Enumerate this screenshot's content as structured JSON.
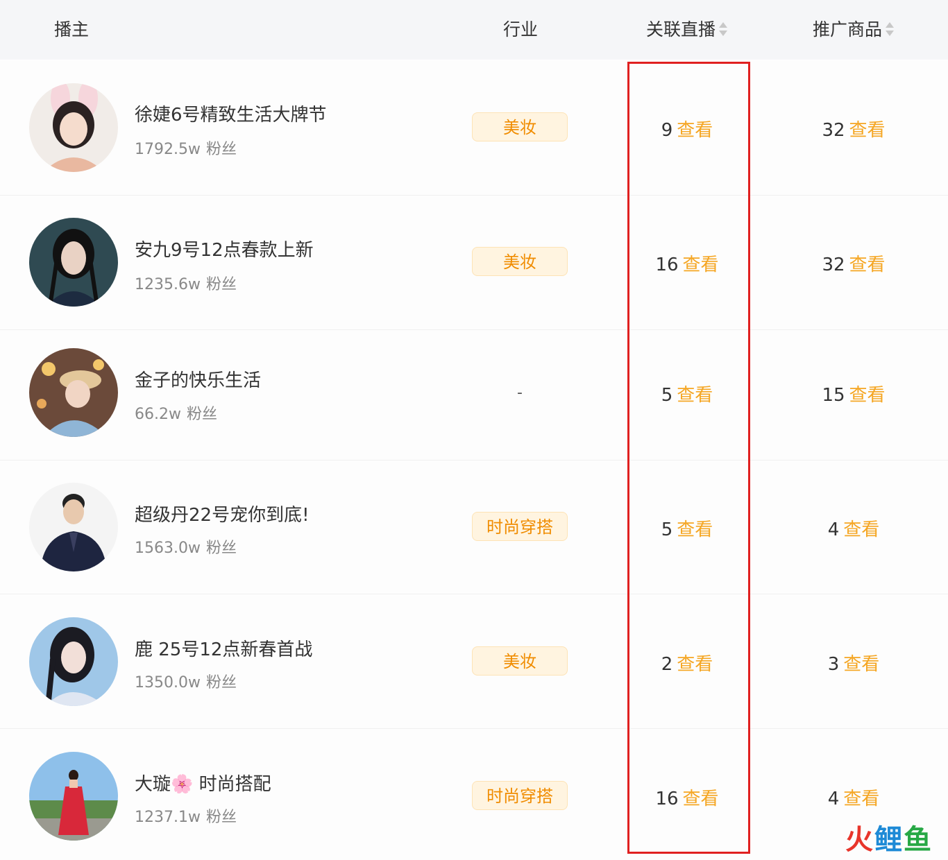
{
  "header": {
    "anchor": "播主",
    "industry": "行业",
    "related_live": "关联直播",
    "promoted_goods": "推广商品"
  },
  "rows": [
    {
      "name": "徐婕6号精致生活大牌节",
      "fans": "1792.5w",
      "fans_unit": "粉丝",
      "industry": "美妆",
      "live_count": "9",
      "goods_count": "32",
      "link": "查看"
    },
    {
      "name": "安九9号12点春款上新",
      "fans": "1235.6w",
      "fans_unit": "粉丝",
      "industry": "美妆",
      "live_count": "16",
      "goods_count": "32",
      "link": "查看"
    },
    {
      "name": "金子的快乐生活",
      "fans": "66.2w",
      "fans_unit": "粉丝",
      "industry": "-",
      "live_count": "5",
      "goods_count": "15",
      "link": "查看"
    },
    {
      "name": "超级丹22号宠你到底!",
      "fans": "1563.0w",
      "fans_unit": "粉丝",
      "industry": "时尚穿搭",
      "live_count": "5",
      "goods_count": "4",
      "link": "查看"
    },
    {
      "name": "鹿 25号12点新春首战",
      "fans": "1350.0w",
      "fans_unit": "粉丝",
      "industry": "美妆",
      "live_count": "2",
      "goods_count": "3",
      "link": "查看"
    },
    {
      "name": "大璇🌸 时尚搭配",
      "fans": "1237.1w",
      "fans_unit": "粉丝",
      "industry": "时尚穿搭",
      "live_count": "16",
      "goods_count": "4",
      "link": "查看"
    }
  ],
  "watermark": {
    "part1": "火",
    "part2": "鲤",
    "part3": "鱼"
  },
  "colors": {
    "link": "#f5a623",
    "tag_bg": "#fff4e0",
    "tag_text": "#f08c00",
    "highlight": "#e02020"
  }
}
